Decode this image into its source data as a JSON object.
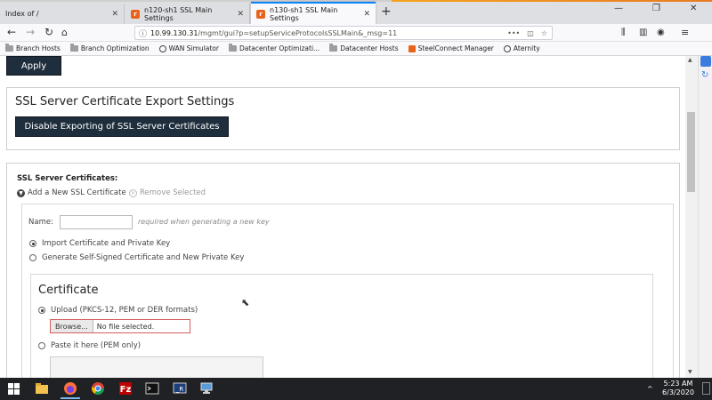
{
  "browser": {
    "tabs": [
      {
        "label": "Index of /"
      },
      {
        "label": "n120-sh1 SSL Main Settings"
      },
      {
        "label": "n130-sh1 SSL Main Settings"
      }
    ],
    "close_glyph": "✕",
    "new_tab_glyph": "+",
    "url": {
      "host": "10.99.130.31",
      "path": "/mgmt/gui?p=setupServiceProtocolsSSLMain&_msg=11"
    },
    "bookmarks": [
      {
        "label": "Branch Hosts",
        "icon": "folder-icon"
      },
      {
        "label": "Branch Optimization",
        "icon": "folder-icon"
      },
      {
        "label": "WAN Simulator",
        "icon": "globe-icon"
      },
      {
        "label": "Datacenter Optimizati...",
        "icon": "folder-icon"
      },
      {
        "label": "Datacenter Hosts",
        "icon": "folder-icon"
      },
      {
        "label": "SteelConnect Manager",
        "icon": "riverbed-icon"
      },
      {
        "label": "Aternity",
        "icon": "globe-icon"
      }
    ]
  },
  "page": {
    "apply_label": "Apply",
    "export_section": {
      "title": "SSL Server Certificate Export Settings",
      "disable_button": "Disable Exporting of SSL Server Certificates"
    },
    "certs_section": {
      "title": "SSL Server Certificates:",
      "add_link": "Add a New SSL Certificate",
      "remove_link": "Remove Selected",
      "name_label": "Name:",
      "name_hint": "required when generating a new key",
      "name_value": "",
      "option_import": "Import Certificate and Private Key",
      "option_generate": "Generate Self-Signed Certificate and New Private Key",
      "certificate": {
        "title": "Certificate",
        "upload_label": "Upload (PKCS-12, PEM or DER formats)",
        "browse_label": "Browse...",
        "file_status": "No file selected.",
        "paste_label": "Paste it here (PEM only)"
      }
    }
  },
  "taskbar": {
    "time": "5:23 AM",
    "date": "6/3/2020",
    "notification_glyph": "^"
  },
  "colors": {
    "dark_button": "#1e2e3c",
    "accent": "#e8641c",
    "taskbar": "#202124"
  }
}
